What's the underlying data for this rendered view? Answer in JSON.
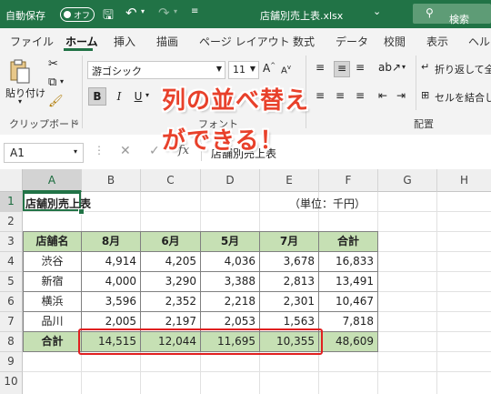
{
  "titlebar": {
    "autosave_label": "自動保存",
    "autosave_state": "オフ",
    "filename": "店舗別売上表.xlsx",
    "filename_arrow": "⌄",
    "search_label": "検索",
    "accent_color": "#217346"
  },
  "tabs": [
    "ファイル",
    "ホーム",
    "挿入",
    "描画",
    "ページ レイアウト",
    "数式",
    "データ",
    "校閲",
    "表示",
    "ヘルプ"
  ],
  "ribbon": {
    "clipboard": {
      "paste_label": "貼り付け",
      "group_label": "クリップボード"
    },
    "font": {
      "font_name": "游ゴシック",
      "font_size": "11",
      "group_label": "フォント",
      "bold": "B",
      "italic": "I",
      "underline": "U"
    },
    "alignment": {
      "wrap_text": "折り返して全",
      "merge": "セルを結合し",
      "group_label": "配置"
    }
  },
  "formula_bar": {
    "name_box": "A1",
    "fx": "fx",
    "content": "店舗別売上表"
  },
  "annotation": {
    "line1": "列の並べ替え",
    "line2": "ができる！"
  },
  "sheet": {
    "columns": [
      "A",
      "B",
      "C",
      "D",
      "E",
      "F",
      "G",
      "H"
    ],
    "rows": [
      "1",
      "2",
      "3",
      "4",
      "5",
      "6",
      "7",
      "8",
      "9",
      "10"
    ],
    "title": "店舗別売上表",
    "unit_note": "（単位：千円）",
    "table_header": [
      "店舗名",
      "8月",
      "6月",
      "5月",
      "7月",
      "合計"
    ],
    "table_rows": [
      [
        "渋谷",
        "4,914",
        "4,205",
        "4,036",
        "3,678",
        "16,833"
      ],
      [
        "新宿",
        "4,000",
        "3,290",
        "3,388",
        "2,813",
        "13,491"
      ],
      [
        "横浜",
        "3,596",
        "2,352",
        "2,218",
        "2,301",
        "10,467"
      ],
      [
        "品川",
        "2,005",
        "2,197",
        "2,053",
        "1,563",
        "7,818"
      ]
    ],
    "total_row": [
      "合計",
      "14,515",
      "12,044",
      "11,695",
      "10,355",
      "48,609"
    ],
    "header_fill_color": "#c6e0b4",
    "highlight_color": "#e02020"
  }
}
